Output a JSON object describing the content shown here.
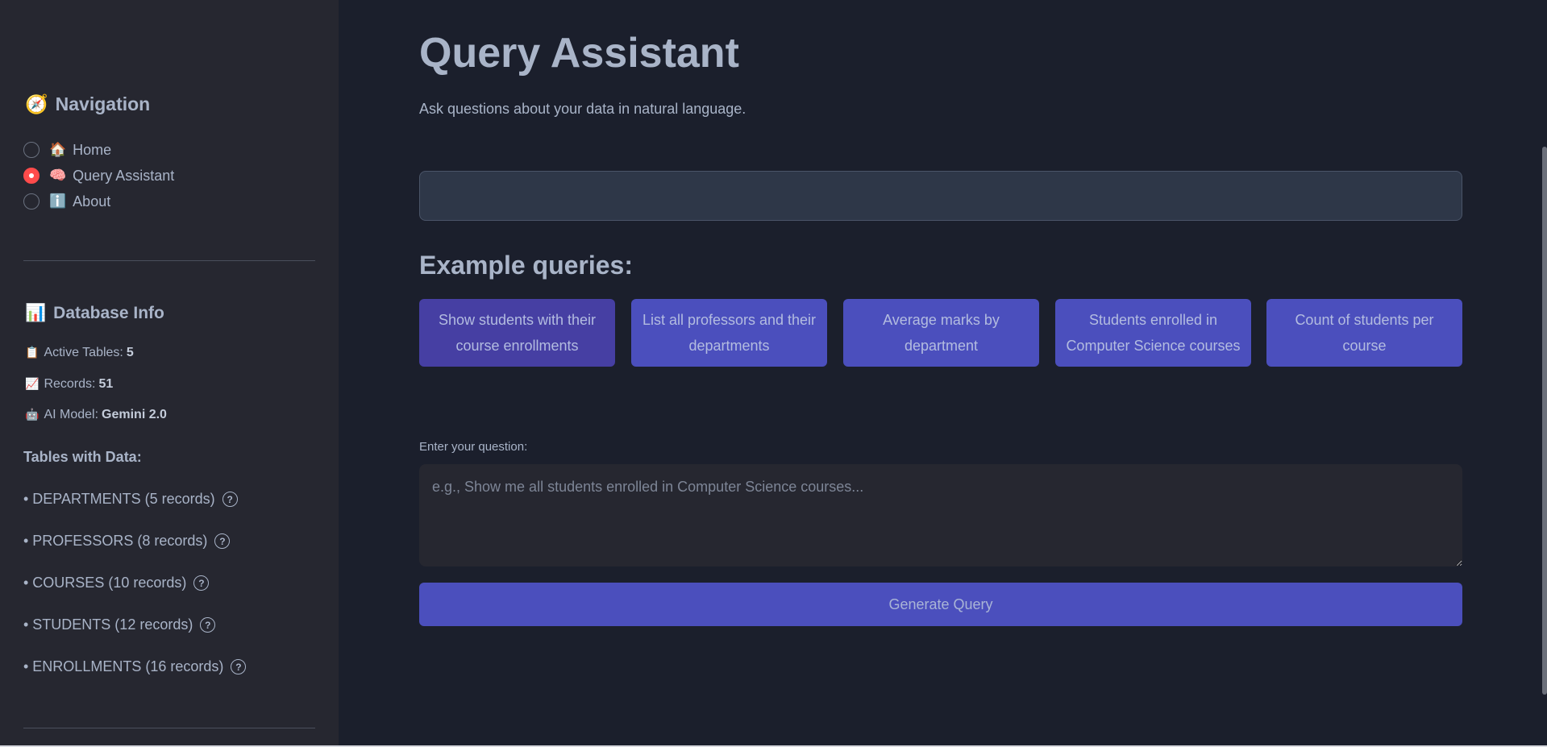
{
  "sidebar": {
    "navigation": {
      "icon": "compass-icon",
      "title": "Navigation",
      "items": [
        {
          "emoji": "🏠",
          "label": "Home",
          "selected": false
        },
        {
          "emoji": "🧠",
          "label": "Query Assistant",
          "selected": true
        },
        {
          "emoji": "ℹ️",
          "label": "About",
          "selected": false
        }
      ]
    },
    "database_info": {
      "icon": "bar-chart-icon",
      "title": "Database Info",
      "active_tables_label": "Active Tables:",
      "active_tables_value": "5",
      "records_label": "Records:",
      "records_value": "51",
      "ai_model_label": "AI Model:",
      "ai_model_value": "Gemini 2.0"
    },
    "tables_heading": "Tables with Data:",
    "tables": [
      "• DEPARTMENTS (5 records)",
      "• PROFESSORS (8 records)",
      "• COURSES (10 records)",
      "• STUDENTS (12 records)",
      "• ENROLLMENTS (16 records)"
    ]
  },
  "main": {
    "title": "Query Assistant",
    "subtitle": "Ask questions about your data in natural language.",
    "examples_heading": "Example queries:",
    "examples": [
      "Show students with their course enrollments",
      "List all professors and their departments",
      "Average marks by department",
      "Students enrolled in Computer Science courses",
      "Count of students per course"
    ],
    "question_label": "Enter your question:",
    "question_placeholder": "e.g., Show me all students enrolled in Computer Science courses...",
    "question_value": "",
    "generate_label": "Generate Query"
  },
  "colors": {
    "sidebar_bg": "#262730",
    "main_bg": "#1b1f2c",
    "button_bg": "#4b4fbd",
    "active_radio": "#ff4b4b"
  }
}
